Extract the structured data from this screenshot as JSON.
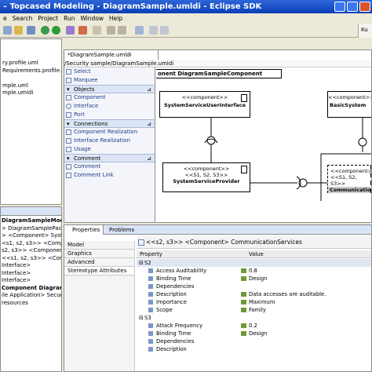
{
  "window": {
    "title": "– Topcased Modeling - DiagramSample.umldi - Eclipse SDK"
  },
  "menu": [
    "e",
    "Search",
    "Project",
    "Run",
    "Window",
    "Help"
  ],
  "perspective_label": "Ku",
  "editor": {
    "tab_label": "*DiagramSample.umldi",
    "path": "/Security sample/DiagramSample.umldi",
    "frame_label": "onent DiagramSampleComponent"
  },
  "navigator": {
    "lines": [
      "ry.profile.uml",
      "Requirements.profile.uml",
      "",
      "mple.uml",
      "mple.umldi"
    ]
  },
  "outline": {
    "lines": [
      "DiagramSampleModel",
      "> DiagramSamplePac",
      "> <Component> SystemSe",
      "<s1, s2, s3>> <Compon",
      "s2, s3>> <Component> B",
      "<<s1, s2, s3>> <Compone",
      "Interface>",
      "Interface>",
      "Interface>",
      "Component Diagram Dr",
      "ile Application> Securi",
      "resources"
    ]
  },
  "palette": {
    "items": [
      {
        "type": "item",
        "label": "Select"
      },
      {
        "type": "item",
        "label": "Marquee"
      },
      {
        "type": "drawer",
        "label": "Objects"
      },
      {
        "type": "item",
        "label": "Component"
      },
      {
        "type": "item",
        "label": "Interface"
      },
      {
        "type": "item",
        "label": "Port"
      },
      {
        "type": "drawer",
        "label": "Connections"
      },
      {
        "type": "item",
        "label": "Component Realization"
      },
      {
        "type": "item",
        "label": "Interface Realization"
      },
      {
        "type": "item",
        "label": "Usage"
      },
      {
        "type": "drawer",
        "label": "Comment"
      },
      {
        "type": "item",
        "label": "Comment"
      },
      {
        "type": "item",
        "label": "Comment Link"
      }
    ]
  },
  "diagram": {
    "components": [
      {
        "stereotype": "<<component>>",
        "name": "SystemServiceUserInterface"
      },
      {
        "stereotype": "<<component>>",
        "name": "BasicSystem"
      },
      {
        "stereotype": "<<component>>\n<<S1, S2, S3>>",
        "name": "SystemServiceProvider"
      },
      {
        "stereotype": "<<component>>\n<<S1, S2, S3>>",
        "name": "Communication"
      }
    ]
  },
  "properties_view": {
    "tabs": [
      "Properties",
      "Problems"
    ],
    "header": "<<s2, s3>> <Component> CommunicationServices",
    "sections": [
      "Model",
      "Graphics",
      "Advanced",
      "Stereotype Attributes"
    ],
    "columns": [
      "Property",
      "Value"
    ],
    "rows": [
      {
        "group": true,
        "name": "S2",
        "value": ""
      },
      {
        "group": false,
        "name": "Access Auditability",
        "value": "0.8"
      },
      {
        "group": false,
        "name": "Binding Time",
        "value": "Design"
      },
      {
        "group": false,
        "name": "Dependencies",
        "value": ""
      },
      {
        "group": false,
        "name": "Description",
        "value": "Data accesses are auditable."
      },
      {
        "group": false,
        "name": "Importance",
        "value": "Maximum"
      },
      {
        "group": false,
        "name": "Scope",
        "value": "Family"
      },
      {
        "group": true,
        "name": "S3",
        "value": ""
      },
      {
        "group": false,
        "name": "Attack Frequency",
        "value": "0.2"
      },
      {
        "group": false,
        "name": "Binding Time",
        "value": "Design"
      },
      {
        "group": false,
        "name": "Dependencies",
        "value": ""
      },
      {
        "group": false,
        "name": "Description",
        "value": ""
      }
    ]
  }
}
